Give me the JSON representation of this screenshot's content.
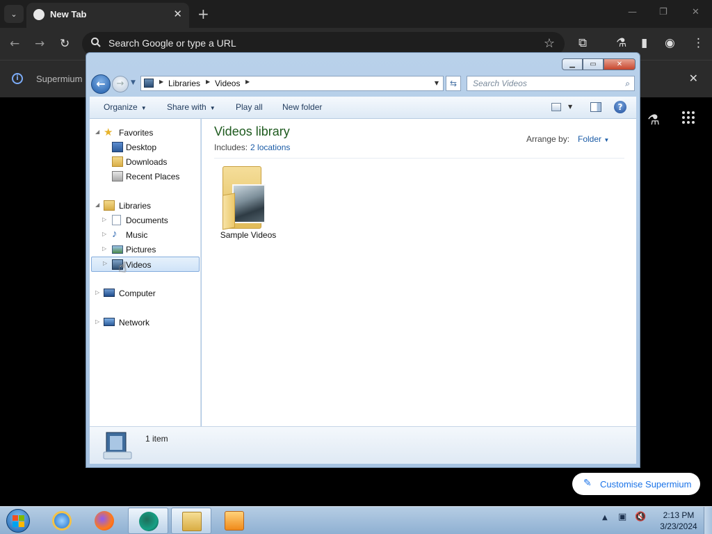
{
  "browser": {
    "tab": {
      "title": "New Tab",
      "close": "✕"
    },
    "new_tab": "+",
    "window_controls": {
      "minimize": "—",
      "restore": "❐",
      "close": "✕"
    },
    "omnibox": {
      "placeholder": "Search Google or type a URL"
    },
    "infobar": {
      "text": "Supermium",
      "close": "✕"
    },
    "customise_button": "Customise Supermium"
  },
  "explorer": {
    "address": {
      "crumbs": [
        "Libraries",
        "Videos"
      ]
    },
    "search_placeholder": "Search Videos",
    "commands": {
      "organize": "Organize",
      "share_with": "Share with",
      "play_all": "Play all",
      "new_folder": "New folder"
    },
    "nav": {
      "favorites": "Favorites",
      "favorites_items": [
        "Desktop",
        "Downloads",
        "Recent Places"
      ],
      "libraries": "Libraries",
      "libraries_items": [
        "Documents",
        "Music",
        "Pictures",
        "Videos"
      ],
      "selected": "Videos",
      "computer": "Computer",
      "network": "Network"
    },
    "library": {
      "title": "Videos library",
      "includes_label": "Includes:",
      "includes_link": "2 locations",
      "arrange_label": "Arrange by:",
      "arrange_value": "Folder"
    },
    "items": [
      {
        "name": "Sample Videos"
      }
    ],
    "details": {
      "count": "1 item"
    }
  },
  "taskbar": {
    "apps": [
      "internet-explorer-icon",
      "firefox-icon",
      "supermium-icon",
      "windows-explorer-icon",
      "media-player-icon"
    ],
    "clock": {
      "time": "2:13 PM",
      "date": "3/23/2024"
    }
  }
}
